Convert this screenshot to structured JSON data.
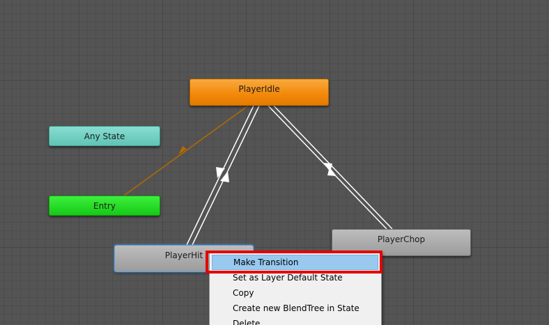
{
  "states": {
    "player_idle": "PlayerIdle",
    "any_state": "Any State",
    "entry": "Entry",
    "player_hit": "PlayerHit",
    "player_chop": "PlayerChop"
  },
  "context_menu": {
    "items": [
      "Make Transition",
      "Set as Layer Default State",
      "Copy",
      "Create new BlendTree in State",
      "Delete"
    ]
  },
  "colors": {
    "idle_state": "#f38a0c",
    "any_state": "#5fc4b6",
    "entry_state": "#16c916",
    "normal_state": "#9b9b9b",
    "selected_outline": "#5aa3e6",
    "menu_highlight": "#99c9ef",
    "annotation_box": "#e40000",
    "default_transition": "#b46a00"
  }
}
